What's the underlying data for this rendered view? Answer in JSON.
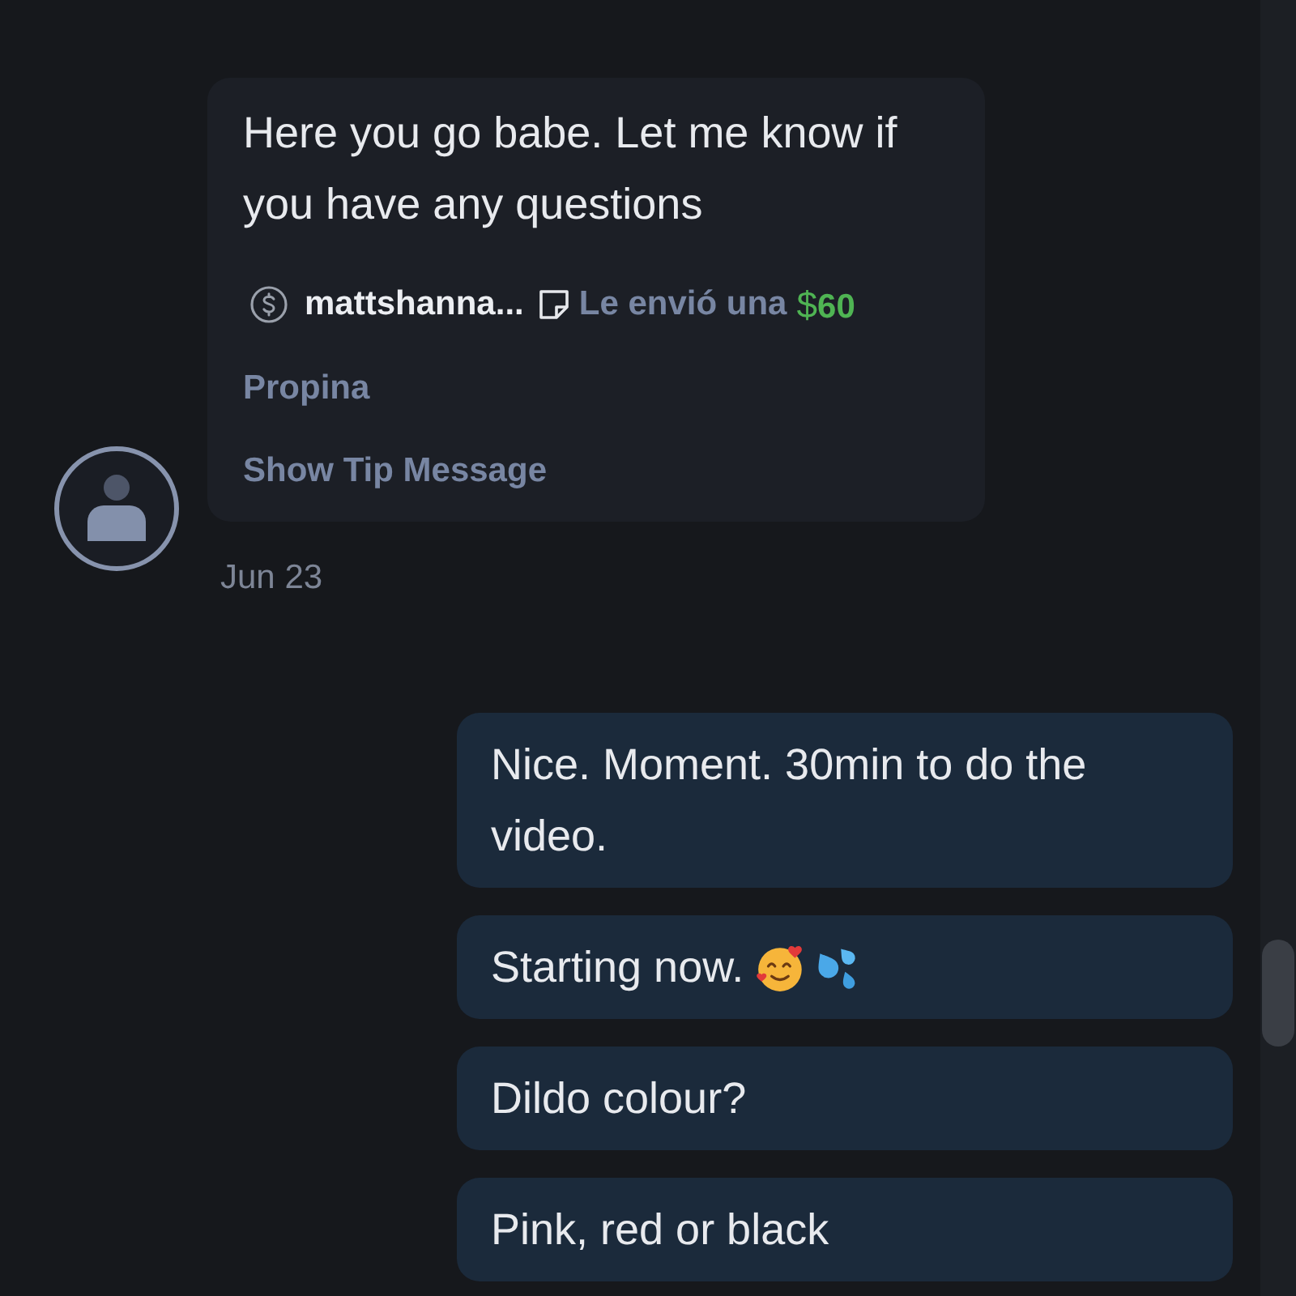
{
  "incoming": {
    "text": "Here you go babe. Let me know if you have any questions",
    "tip": {
      "sender": "mattshanna...",
      "action": "Le envió una",
      "currency": "$",
      "amount": "60",
      "label": "Propina",
      "link": "Show Tip Message"
    },
    "date": "Jun 23"
  },
  "outgoing": [
    {
      "text": "Nice. Moment. 30min to do the video."
    },
    {
      "text": "Starting now.",
      "emoji": [
        {
          "kind": "smiling_hearts"
        },
        {
          "kind": "droplets"
        }
      ]
    },
    {
      "text": "Dildo colour?"
    },
    {
      "text": "Pink, red or black"
    }
  ]
}
